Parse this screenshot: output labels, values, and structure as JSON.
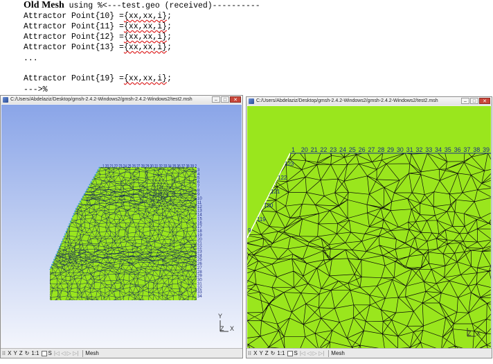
{
  "code": {
    "line1_bold": "Old Mesh",
    "line1_rest": " using %<---test.geo (received)----------",
    "lines": [
      {
        "prefix": "Attractor Point{10} =",
        "args": "{xx,xx,i}",
        "suffix": ";"
      },
      {
        "prefix": "Attractor Point{11} =",
        "args": "{xx,xx,i}",
        "suffix": ";"
      },
      {
        "prefix": "Attractor Point{12} =",
        "args": "{xx,xx,i}",
        "suffix": ";"
      },
      {
        "prefix": "Attractor Point{13} =",
        "args": "{xx,xx,i}",
        "suffix": ";"
      }
    ],
    "ellipsis": "...",
    "last_line": {
      "prefix": "Attractor Point{19} =",
      "args": "{xx,xx,i}",
      "suffix": ";"
    },
    "end_marker": "--->%"
  },
  "left_window": {
    "title": "C:/Users/Abdelaziz/Desktop/gmsh-2.4.2-Windows2/gmsh-2.4.2-Windows2/test2.msh",
    "minimize": "–",
    "maximize": "□",
    "close": "✕",
    "axis_y": "Y",
    "axis_z": "Z",
    "axis_x": "X",
    "top_labels": "1 20 21 22 23 24 25 26 27 28 29 30 31 32 33 34 35 36 37 38 39 2",
    "right_labels": [
      "3",
      "4",
      "5",
      "6",
      "7",
      "8",
      "9",
      "10",
      "11",
      "12",
      "13",
      "14",
      "15",
      "16",
      "17",
      "18",
      "19",
      "20",
      "21",
      "22",
      "23",
      "24",
      "25",
      "26",
      "27",
      "28",
      "29",
      "30",
      "31",
      "32",
      "33",
      "34"
    ],
    "status": {
      "x": "X",
      "y": "Y",
      "z": "Z",
      "rotate": "↻",
      "scale": "1:1",
      "s": "S",
      "mode": "Mesh"
    },
    "mesh_fill": "#9ae61d",
    "mesh_edges": "#0b1a5c",
    "bg_top": "#8aa5e8",
    "bg_bottom": "#f4f6fc"
  },
  "right_window": {
    "title": "C:/Users/Abdelaziz/Desktop/gmsh-2.4.2-Windows2/gmsh-2.4.2-Windows2/test2.msh",
    "minimize": "–",
    "maximize": "□",
    "close": "✕",
    "axis_z": "Z",
    "axis_x": "X",
    "top_labels": [
      "1",
      "20",
      "21",
      "22",
      "23",
      "24",
      "25",
      "26",
      "27",
      "28",
      "29",
      "30",
      "31",
      "32",
      "33",
      "34",
      "35",
      "36",
      "37",
      "38",
      "39"
    ],
    "left_labels": [
      "123",
      "122",
      "121",
      "120",
      "119",
      "9"
    ],
    "status": {
      "x": "X",
      "y": "Y",
      "z": "Z",
      "rotate": "↻",
      "scale": "1:1",
      "s": "S",
      "mode": "Mesh"
    },
    "mesh_fill": "#9ae61d",
    "mesh_edges": "#0a0a0a"
  }
}
